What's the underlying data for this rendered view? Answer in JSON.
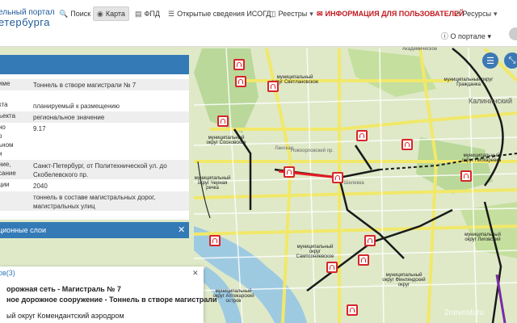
{
  "header": {
    "logo_line1": "ельный портал",
    "logo_line2": "етербурга",
    "nav": [
      {
        "label": "Поиск",
        "icon": "search-icon"
      },
      {
        "label": "Карта",
        "icon": "globe-icon"
      },
      {
        "label": "ФПД",
        "icon": "book-icon"
      },
      {
        "label": "Открытые сведения ИСОГД",
        "icon": "list-icon"
      },
      {
        "label": "Реестры",
        "icon": "folder-icon"
      },
      {
        "label": "ИНФОРМАЦИЯ ДЛЯ ПОЛЬЗОВАТЕЛЕЙ",
        "icon": "comment-icon"
      },
      {
        "label": "Ресурсы",
        "icon": "external-link-icon"
      }
    ],
    "portal_link": "О портале"
  },
  "info": {
    "rows": [
      {
        "label": "име",
        "value": "Тоннель в створе магистрали № 7"
      },
      {
        "label": "кта",
        "value": "планируемый к размещению"
      },
      {
        "label": "ъекта",
        "value": "региональное значение"
      },
      {
        "label": "но\nо\nьном\nи",
        "value": "9.17"
      },
      {
        "label": "ние,\nсание",
        "value": "Санкт-Петербург, от Политехнической ул. до Скобелевского пр."
      },
      {
        "label": "ции",
        "value": "2040"
      },
      {
        "label": "",
        "value": "тоннель в составе магистральных дорог, магистральных улиц"
      }
    ]
  },
  "layers": {
    "title": "ционные слои",
    "close": "✕"
  },
  "popup": {
    "count": "ов(3)",
    "close": "✕",
    "line1": "орожная сеть - Магистраль № 7",
    "line2": "ное дорожное сооружение - Тоннель в створе магистрали",
    "line3": "ый округ Комендантский аэродром"
  },
  "map": {
    "labels": [
      "Академическое",
      "муниципальный округ Светлановское",
      "муниципальный округ Гражданка",
      "Калининский",
      "муниципальный округ Пискаревка",
      "муниципальный округ Сосновское",
      "муниципальный округ Черная речка",
      "Новоорловский пр.",
      "Ланская",
      "Шелевка",
      "муниципальный округ Сампсониевское",
      "муниципальный округ Лиговский",
      "муниципальный округ Аптекарский остров",
      "муниципальный округ Финляндский округ"
    ]
  },
  "watermark": "2nevosti.ru",
  "colors": {
    "accent": "#337ab7",
    "alert": "#c0191f",
    "map_bg": "#dfe9c8",
    "marker": "#d7262b"
  }
}
